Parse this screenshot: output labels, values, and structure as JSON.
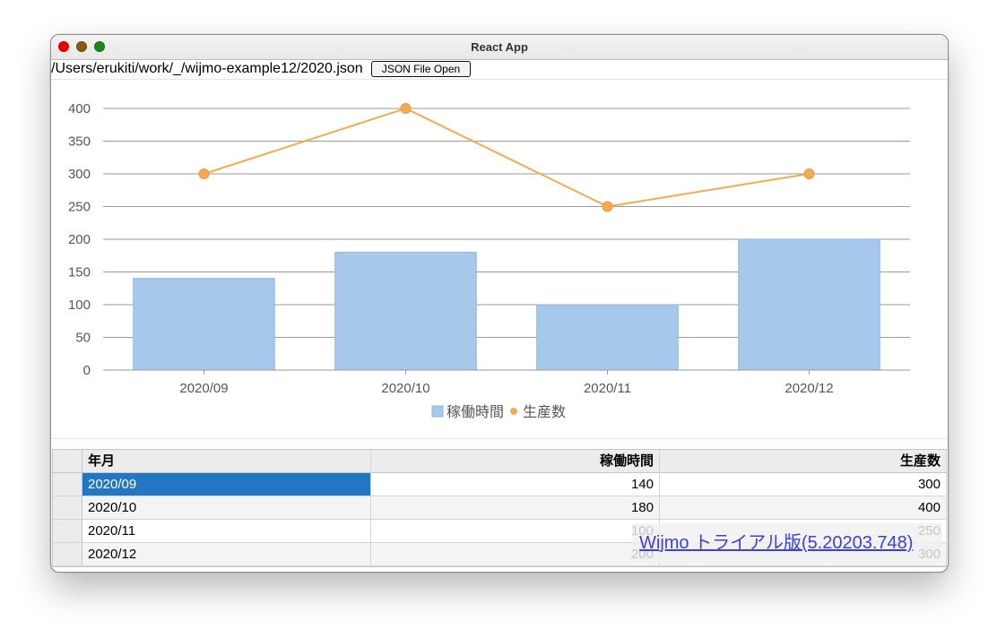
{
  "window": {
    "title": "React App"
  },
  "filebar": {
    "path": "/Users/erukiti/work/_/wijmo-example12/2020.json",
    "open_label": "JSON File Open"
  },
  "chart_data": {
    "type": "bar",
    "categories": [
      "2020/09",
      "2020/10",
      "2020/11",
      "2020/12"
    ],
    "series": [
      {
        "name": "稼働時間",
        "type": "bar",
        "values": [
          140,
          180,
          100,
          200
        ],
        "color": "#a6c8ea"
      },
      {
        "name": "生産数",
        "type": "line",
        "values": [
          300,
          400,
          250,
          300
        ],
        "color": "#f2ab54"
      }
    ],
    "y_ticks": [
      0,
      50,
      100,
      150,
      200,
      250,
      300,
      350,
      400
    ],
    "ylim": [
      0,
      400
    ],
    "grid": true,
    "legend_position": "bottom",
    "xlabel": "",
    "ylabel": ""
  },
  "grid": {
    "headers": [
      "年月",
      "稼働時間",
      "生産数"
    ],
    "rows": [
      {
        "month": "2020/09",
        "hours": "140",
        "production": "300"
      },
      {
        "month": "2020/10",
        "hours": "180",
        "production": "400"
      },
      {
        "month": "2020/11",
        "hours": "100",
        "production": "250"
      },
      {
        "month": "2020/12",
        "hours": "200",
        "production": "300"
      }
    ]
  },
  "watermark": {
    "text": "Wijmo トライアル版(5.20203.748)"
  }
}
